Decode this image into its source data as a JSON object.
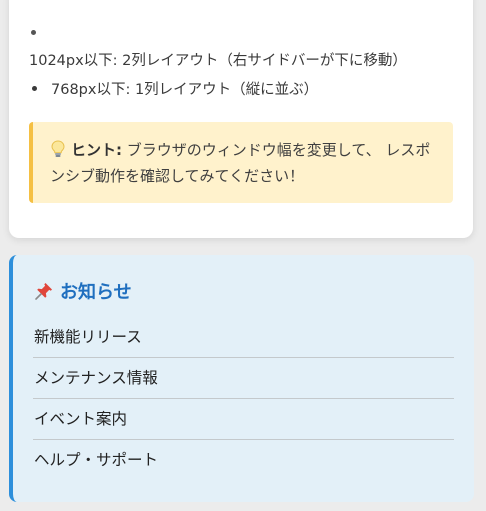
{
  "layout_list": {
    "item_1024": "1024px以下: 2列レイアウト（右サイドバーが下に移動）",
    "item_768": "768px以下: 1列レイアウト（縦に並ぶ）"
  },
  "hint": {
    "icon": "lightbulb-icon",
    "label": "ヒント:",
    "text": " ブラウザのウィンドウ幅を変更して、 レスポンシブ動作を確認してみてください！"
  },
  "notice": {
    "icon": "pushpin-icon",
    "title": "お知らせ",
    "items": [
      "新機能リリース",
      "メンテナンス情報",
      "イベント案内",
      "ヘルプ・サポート"
    ]
  },
  "colors": {
    "accent_blue": "#2d8fdb",
    "notice_bg": "#e3f0f8",
    "hint_bg": "#fff2cc",
    "hint_border": "#f5c043"
  }
}
